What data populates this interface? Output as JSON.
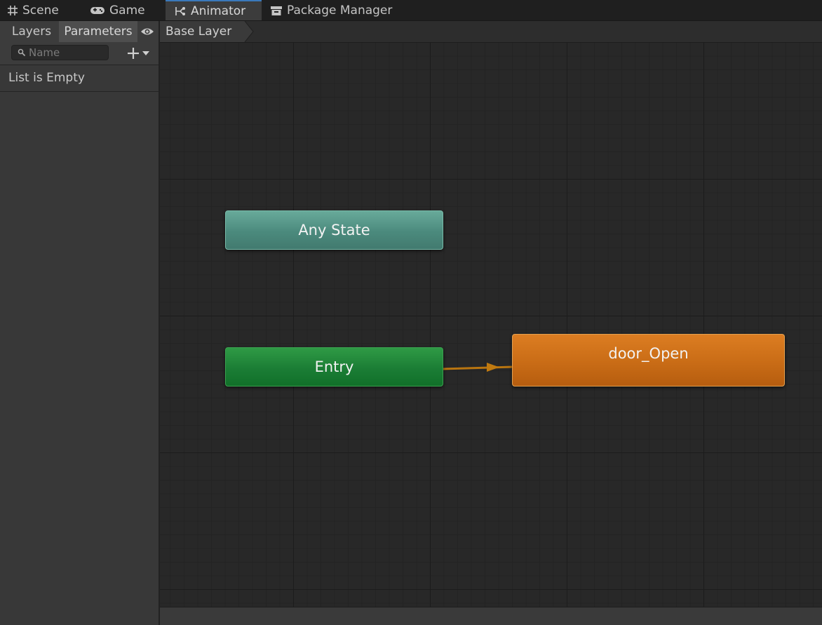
{
  "tabs": [
    {
      "label": "Scene",
      "icon": "grid-icon"
    },
    {
      "label": "Game",
      "icon": "gamepad-icon"
    },
    {
      "label": "Animator",
      "icon": "animator-icon",
      "active": true
    },
    {
      "label": "Package Manager",
      "icon": "package-icon"
    }
  ],
  "left_panel": {
    "tabs": [
      "Layers",
      "Parameters"
    ],
    "active_tab": "Parameters",
    "search_placeholder": "Name",
    "search_value": "",
    "empty_message": "List is Empty"
  },
  "breadcrumb": [
    "Base Layer"
  ],
  "graph": {
    "nodes": [
      {
        "id": "any_state",
        "label": "Any State",
        "color": "#5a9c8c"
      },
      {
        "id": "entry",
        "label": "Entry",
        "color": "#1d8238"
      },
      {
        "id": "door_open",
        "label": "door_Open",
        "color": "#cb6e18"
      }
    ],
    "transitions": [
      {
        "from": "entry",
        "to": "door_open",
        "color": "#c07a10"
      }
    ]
  },
  "colors": {
    "active_tab_accent": "#3a79bb"
  }
}
